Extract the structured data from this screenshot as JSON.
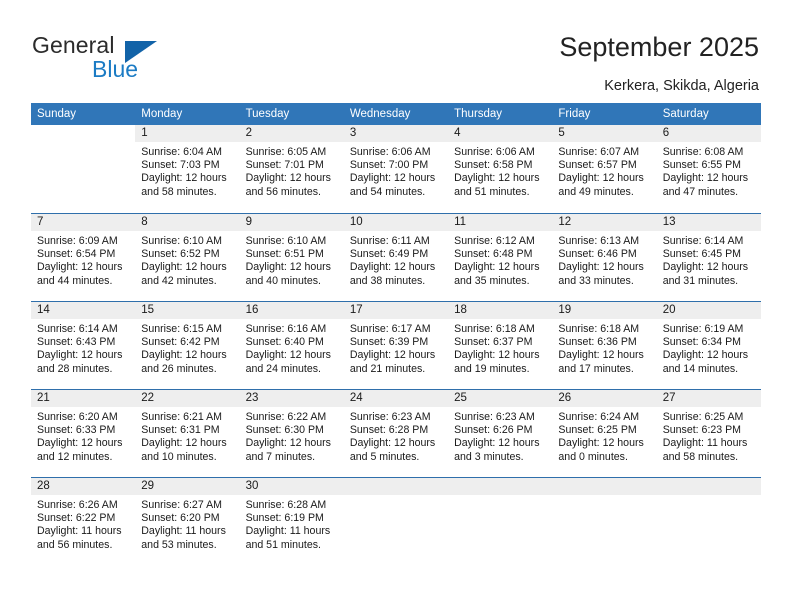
{
  "brand": {
    "name_part1": "General",
    "name_part2": "Blue",
    "accent_color": "#1b7bc4",
    "triangle_color": "#1263a8"
  },
  "header": {
    "title": "September 2025",
    "subtitle": "Kerkera, Skikda, Algeria"
  },
  "calendar": {
    "header_bg": "#3076b8",
    "weekdays": [
      "Sunday",
      "Monday",
      "Tuesday",
      "Wednesday",
      "Thursday",
      "Friday",
      "Saturday"
    ],
    "weeks": [
      [
        {
          "day": "",
          "lines": []
        },
        {
          "day": "1",
          "lines": [
            "Sunrise: 6:04 AM",
            "Sunset: 7:03 PM",
            "Daylight: 12 hours",
            "and 58 minutes."
          ]
        },
        {
          "day": "2",
          "lines": [
            "Sunrise: 6:05 AM",
            "Sunset: 7:01 PM",
            "Daylight: 12 hours",
            "and 56 minutes."
          ]
        },
        {
          "day": "3",
          "lines": [
            "Sunrise: 6:06 AM",
            "Sunset: 7:00 PM",
            "Daylight: 12 hours",
            "and 54 minutes."
          ]
        },
        {
          "day": "4",
          "lines": [
            "Sunrise: 6:06 AM",
            "Sunset: 6:58 PM",
            "Daylight: 12 hours",
            "and 51 minutes."
          ]
        },
        {
          "day": "5",
          "lines": [
            "Sunrise: 6:07 AM",
            "Sunset: 6:57 PM",
            "Daylight: 12 hours",
            "and 49 minutes."
          ]
        },
        {
          "day": "6",
          "lines": [
            "Sunrise: 6:08 AM",
            "Sunset: 6:55 PM",
            "Daylight: 12 hours",
            "and 47 minutes."
          ]
        }
      ],
      [
        {
          "day": "7",
          "lines": [
            "Sunrise: 6:09 AM",
            "Sunset: 6:54 PM",
            "Daylight: 12 hours",
            "and 44 minutes."
          ]
        },
        {
          "day": "8",
          "lines": [
            "Sunrise: 6:10 AM",
            "Sunset: 6:52 PM",
            "Daylight: 12 hours",
            "and 42 minutes."
          ]
        },
        {
          "day": "9",
          "lines": [
            "Sunrise: 6:10 AM",
            "Sunset: 6:51 PM",
            "Daylight: 12 hours",
            "and 40 minutes."
          ]
        },
        {
          "day": "10",
          "lines": [
            "Sunrise: 6:11 AM",
            "Sunset: 6:49 PM",
            "Daylight: 12 hours",
            "and 38 minutes."
          ]
        },
        {
          "day": "11",
          "lines": [
            "Sunrise: 6:12 AM",
            "Sunset: 6:48 PM",
            "Daylight: 12 hours",
            "and 35 minutes."
          ]
        },
        {
          "day": "12",
          "lines": [
            "Sunrise: 6:13 AM",
            "Sunset: 6:46 PM",
            "Daylight: 12 hours",
            "and 33 minutes."
          ]
        },
        {
          "day": "13",
          "lines": [
            "Sunrise: 6:14 AM",
            "Sunset: 6:45 PM",
            "Daylight: 12 hours",
            "and 31 minutes."
          ]
        }
      ],
      [
        {
          "day": "14",
          "lines": [
            "Sunrise: 6:14 AM",
            "Sunset: 6:43 PM",
            "Daylight: 12 hours",
            "and 28 minutes."
          ]
        },
        {
          "day": "15",
          "lines": [
            "Sunrise: 6:15 AM",
            "Sunset: 6:42 PM",
            "Daylight: 12 hours",
            "and 26 minutes."
          ]
        },
        {
          "day": "16",
          "lines": [
            "Sunrise: 6:16 AM",
            "Sunset: 6:40 PM",
            "Daylight: 12 hours",
            "and 24 minutes."
          ]
        },
        {
          "day": "17",
          "lines": [
            "Sunrise: 6:17 AM",
            "Sunset: 6:39 PM",
            "Daylight: 12 hours",
            "and 21 minutes."
          ]
        },
        {
          "day": "18",
          "lines": [
            "Sunrise: 6:18 AM",
            "Sunset: 6:37 PM",
            "Daylight: 12 hours",
            "and 19 minutes."
          ]
        },
        {
          "day": "19",
          "lines": [
            "Sunrise: 6:18 AM",
            "Sunset: 6:36 PM",
            "Daylight: 12 hours",
            "and 17 minutes."
          ]
        },
        {
          "day": "20",
          "lines": [
            "Sunrise: 6:19 AM",
            "Sunset: 6:34 PM",
            "Daylight: 12 hours",
            "and 14 minutes."
          ]
        }
      ],
      [
        {
          "day": "21",
          "lines": [
            "Sunrise: 6:20 AM",
            "Sunset: 6:33 PM",
            "Daylight: 12 hours",
            "and 12 minutes."
          ]
        },
        {
          "day": "22",
          "lines": [
            "Sunrise: 6:21 AM",
            "Sunset: 6:31 PM",
            "Daylight: 12 hours",
            "and 10 minutes."
          ]
        },
        {
          "day": "23",
          "lines": [
            "Sunrise: 6:22 AM",
            "Sunset: 6:30 PM",
            "Daylight: 12 hours",
            "and 7 minutes."
          ]
        },
        {
          "day": "24",
          "lines": [
            "Sunrise: 6:23 AM",
            "Sunset: 6:28 PM",
            "Daylight: 12 hours",
            "and 5 minutes."
          ]
        },
        {
          "day": "25",
          "lines": [
            "Sunrise: 6:23 AM",
            "Sunset: 6:26 PM",
            "Daylight: 12 hours",
            "and 3 minutes."
          ]
        },
        {
          "day": "26",
          "lines": [
            "Sunrise: 6:24 AM",
            "Sunset: 6:25 PM",
            "Daylight: 12 hours",
            "and 0 minutes."
          ]
        },
        {
          "day": "27",
          "lines": [
            "Sunrise: 6:25 AM",
            "Sunset: 6:23 PM",
            "Daylight: 11 hours",
            "and 58 minutes."
          ]
        }
      ],
      [
        {
          "day": "28",
          "lines": [
            "Sunrise: 6:26 AM",
            "Sunset: 6:22 PM",
            "Daylight: 11 hours",
            "and 56 minutes."
          ]
        },
        {
          "day": "29",
          "lines": [
            "Sunrise: 6:27 AM",
            "Sunset: 6:20 PM",
            "Daylight: 11 hours",
            "and 53 minutes."
          ]
        },
        {
          "day": "30",
          "lines": [
            "Sunrise: 6:28 AM",
            "Sunset: 6:19 PM",
            "Daylight: 11 hours",
            "and 51 minutes."
          ]
        },
        {
          "day": "",
          "lines": []
        },
        {
          "day": "",
          "lines": []
        },
        {
          "day": "",
          "lines": []
        },
        {
          "day": "",
          "lines": []
        }
      ]
    ]
  }
}
